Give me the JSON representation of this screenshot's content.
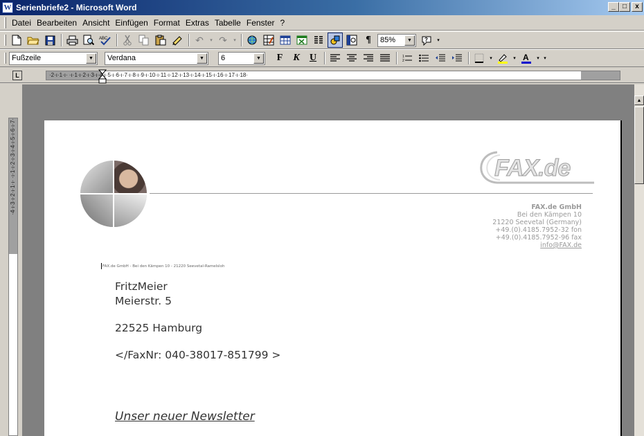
{
  "window": {
    "title": "Serienbriefe2 - Microsoft Word",
    "app_icon": "W",
    "controls": {
      "minimize": "_",
      "maximize": "□",
      "close": "x"
    }
  },
  "menu": [
    "Datei",
    "Bearbeiten",
    "Ansicht",
    "Einfügen",
    "Format",
    "Extras",
    "Tabelle",
    "Fenster",
    "?"
  ],
  "standard_toolbar": {
    "zoom": "85%",
    "icons": [
      "new-document-icon",
      "open-folder-icon",
      "save-icon",
      "print-icon",
      "print-preview-icon",
      "spelling-icon",
      "cut-icon",
      "copy-icon",
      "paste-icon",
      "format-painter-icon",
      "undo-icon",
      "redo-icon",
      "hyperlink-icon",
      "tables-borders-icon",
      "insert-table-icon",
      "insert-excel-icon",
      "columns-icon",
      "drawing-icon",
      "document-map-icon",
      "show-formatting-icon",
      "help-icon"
    ]
  },
  "formatting_toolbar": {
    "style": "Fußzeile",
    "font": "Verdana",
    "size": "6",
    "bold": "F",
    "italic": "K",
    "underline": "U"
  },
  "ruler": {
    "horizontal": "·2·ı·1·ı·  ·ı·1·ı·2·ı·3·ı·4·ı·5·ı·6·ı·7·ı·8·ı·9·ı·10·ı·11·ı·12·ı·13·ı·14·ı·15·ı·16·ı·17·ı·18·",
    "vertical": "·4·ı·3·ı·2·ı·1·ı·  ·ı·1·ı·2·ı·3·ı·4·ı·5·ı·6·ı·7·"
  },
  "letter": {
    "logo_text": "FAX.de",
    "company": {
      "name": "FAX.de GmbH",
      "street": "Bei den Kämpen 10",
      "city": "21220 Seevetal (Germany)",
      "fon": "+49.(0).4185.7952-32 fon",
      "fax": "+49.(0).4185.7952-96 fax",
      "email": "info@FAX.de"
    },
    "sender_line": "FAX.de GmbH - Bei den Kämpen 10 - 21220 Seevetal-Ramelsloh",
    "recipient": {
      "name": "FritzMeier",
      "street": "Meierstr. 5",
      "city": "22525 Hamburg",
      "fax": "</FaxNr: 040-38017-851799 >"
    },
    "subject": "Unser neuer Newsletter"
  }
}
